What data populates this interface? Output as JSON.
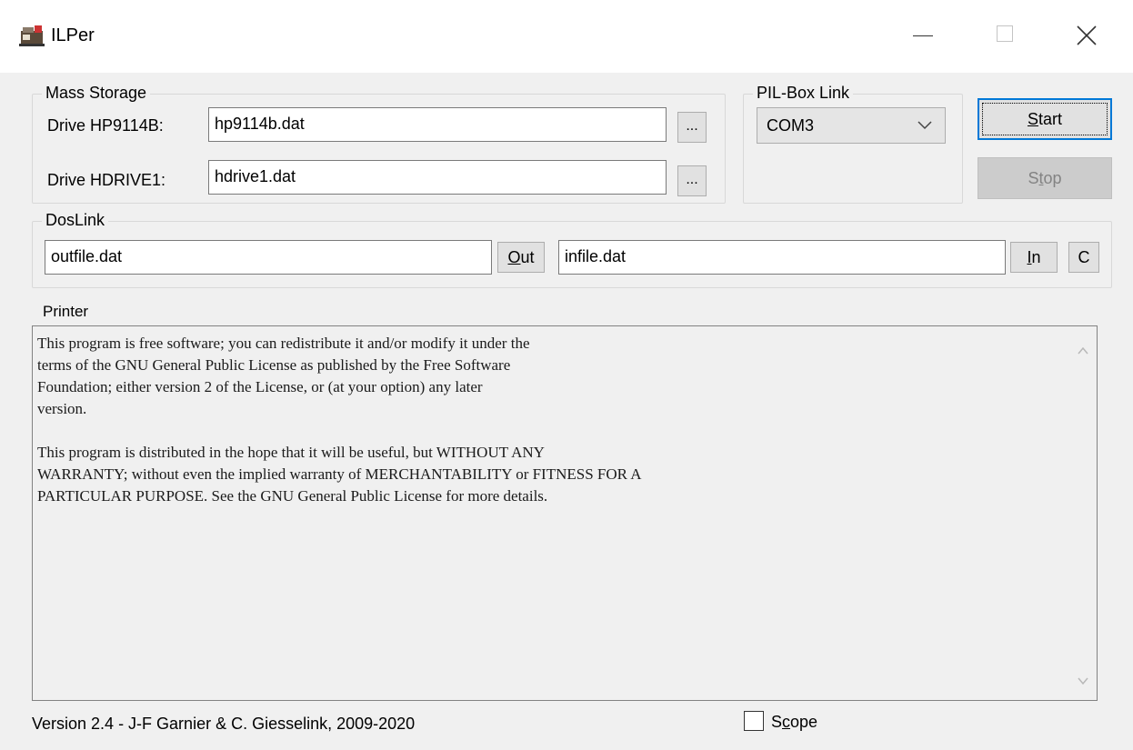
{
  "window": {
    "title": "ILPer"
  },
  "mass_storage": {
    "legend": "Mass Storage",
    "drive1_label": "Drive HP9114B:",
    "drive1_value": "hp9114b.dat",
    "drive2_label": "Drive HDRIVE1:",
    "drive2_value": "hdrive1.dat",
    "browse_label": "..."
  },
  "pilbox": {
    "legend": "PIL-Box Link",
    "port_selected": "COM3"
  },
  "buttons": {
    "start_first": "S",
    "start_rest": "tart",
    "stop_first": "S",
    "stop_ul": "t",
    "stop_rest": "op"
  },
  "doslink": {
    "legend": "DosLink",
    "out_value": "outfile.dat",
    "out_btn_ul": "O",
    "out_btn_rest": "ut",
    "in_value": "infile.dat",
    "in_btn_ul": "I",
    "in_btn_rest": "n",
    "c_btn": "C"
  },
  "printer": {
    "label": "Printer",
    "text": "This program is free software; you can redistribute it and/or modify it under the\nterms of the GNU General Public License as published by the Free Software\nFoundation; either version 2 of the License, or (at your option) any later\nversion.\n\nThis program is distributed in the hope that it will be useful, but WITHOUT ANY\nWARRANTY; without even the implied warranty of MERCHANTABILITY or FITNESS FOR A\nPARTICULAR PURPOSE. See the GNU General Public License for more details."
  },
  "status": {
    "version": "Version 2.4  - J-F Garnier & C. Giesselink, 2009-2020",
    "scope_first": "S",
    "scope_ul": "c",
    "scope_rest": "ope",
    "scope_checked": false
  }
}
